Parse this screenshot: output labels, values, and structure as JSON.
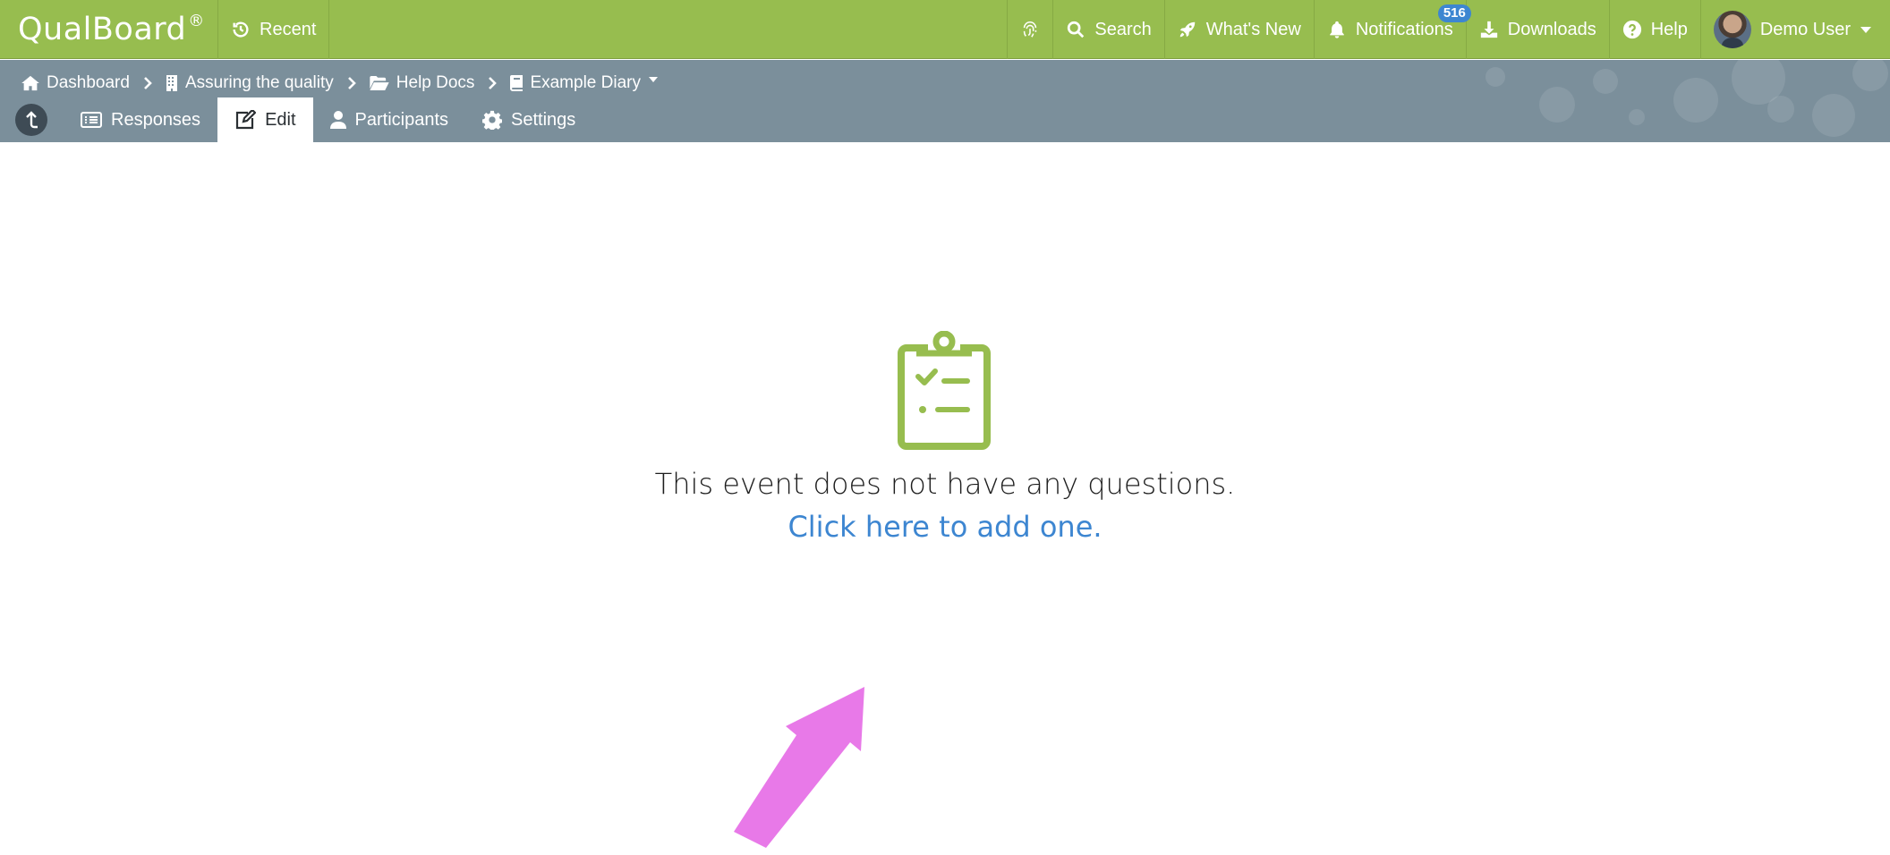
{
  "brand": {
    "name": "QualBoard",
    "mark": "®"
  },
  "topbar": {
    "recent_label": "Recent",
    "search_label": "Search",
    "whats_new_label": "What's New",
    "notifications_label": "Notifications",
    "notifications_count": "516",
    "downloads_label": "Downloads",
    "help_label": "Help",
    "user_label": "Demo User"
  },
  "breadcrumb": {
    "items": [
      {
        "label": "Dashboard",
        "icon": "home-icon"
      },
      {
        "label": "Assuring the quality",
        "icon": "building-icon"
      },
      {
        "label": "Help Docs",
        "icon": "folder-open-icon"
      },
      {
        "label": "Example Diary",
        "icon": "book-icon"
      }
    ]
  },
  "tabs": [
    {
      "label": "Responses",
      "icon": "list-alt-icon",
      "active": false
    },
    {
      "label": "Edit",
      "icon": "edit-icon",
      "active": true
    },
    {
      "label": "Participants",
      "icon": "user-icon",
      "active": false
    },
    {
      "label": "Settings",
      "icon": "gear-icon",
      "active": false
    }
  ],
  "empty_state": {
    "message": "This event does not have any questions.",
    "link_label": "Click here to add one.",
    "icon": "clipboard-checklist-icon"
  },
  "colors": {
    "brand_green": "#97bd4f",
    "subheader_gray": "#7b8f9b",
    "link_blue": "#3d86d1",
    "badge_blue": "#3d86d1",
    "annotation_arrow": "#e879e8"
  }
}
